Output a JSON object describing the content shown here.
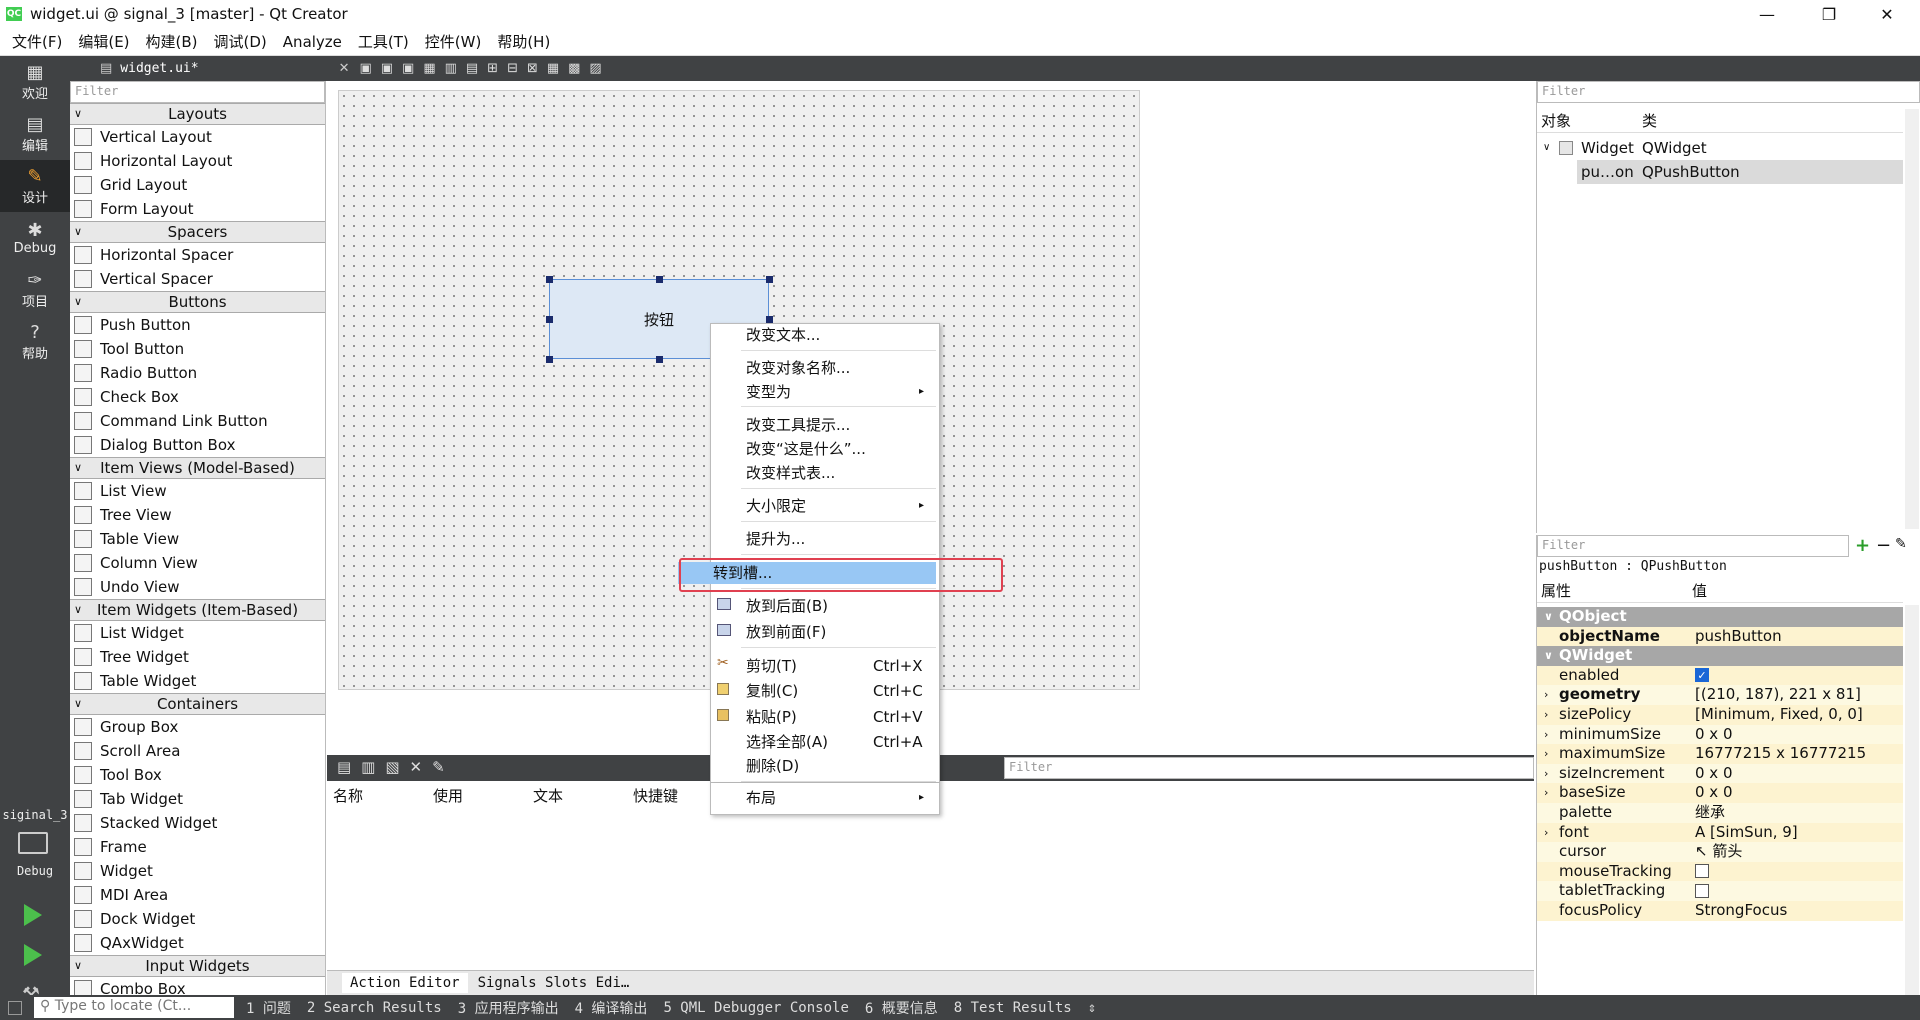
{
  "window": {
    "title": "widget.ui @ signal_3 [master] - Qt Creator",
    "min": "—",
    "max": "❐",
    "close": "✕",
    "app_icon": "QC"
  },
  "menu": [
    "文件(F)",
    "编辑(E)",
    "构建(B)",
    "调试(D)",
    "Analyze",
    "工具(T)",
    "控件(W)",
    "帮助(H)"
  ],
  "modes": [
    {
      "label": "欢迎",
      "icon": "▦"
    },
    {
      "label": "编辑",
      "icon": "▤"
    },
    {
      "label": "设计",
      "icon": "✎"
    },
    {
      "label": "Debug",
      "icon": "✱"
    },
    {
      "label": "项目",
      "icon": "✑"
    },
    {
      "label": "帮助",
      "icon": "?"
    }
  ],
  "kit": {
    "project": "siginal_3",
    "label": "Debug"
  },
  "doc": {
    "file": "widget.ui*"
  },
  "widgetbox": {
    "filter": "Filter",
    "groups": [
      {
        "title": "Layouts",
        "items": [
          "Vertical Layout",
          "Horizontal Layout",
          "Grid Layout",
          "Form Layout"
        ]
      },
      {
        "title": "Spacers",
        "items": [
          "Horizontal Spacer",
          "Vertical Spacer"
        ]
      },
      {
        "title": "Buttons",
        "items": [
          "Push Button",
          "Tool Button",
          "Radio Button",
          "Check Box",
          "Command Link Button",
          "Dialog Button Box"
        ]
      },
      {
        "title": "Item Views (Model-Based)",
        "items": [
          "List View",
          "Tree View",
          "Table View",
          "Column View",
          "Undo View"
        ]
      },
      {
        "title": "Item Widgets (Item-Based)",
        "items": [
          "List Widget",
          "Tree Widget",
          "Table Widget"
        ]
      },
      {
        "title": "Containers",
        "items": [
          "Group Box",
          "Scroll Area",
          "Tool Box",
          "Tab Widget",
          "Stacked Widget",
          "Frame",
          "Widget",
          "MDI Area",
          "Dock Widget",
          "QAxWidget"
        ]
      },
      {
        "title": "Input Widgets",
        "items": [
          "Combo Box"
        ]
      }
    ]
  },
  "canvas": {
    "button_text": "按钮"
  },
  "context_menu": {
    "items": {
      "change_text": "改变文本...",
      "change_name": "改变对象名称...",
      "morph": "变型为",
      "tooltip": "改变工具提示...",
      "whats_this": "改变“这是什么”...",
      "stylesheet": "改变样式表...",
      "size_constraints": "大小限定",
      "promote": "提升为...",
      "goto_slot": "转到槽...",
      "send_back": "放到后面(B)",
      "bring_front": "放到前面(F)",
      "cut": "剪切(T)",
      "copy": "复制(C)",
      "paste": "粘贴(P)",
      "select_all": "选择全部(A)",
      "delete": "删除(D)",
      "layout": "布局"
    },
    "shortcuts": {
      "cut": "Ctrl+X",
      "copy": "Ctrl+C",
      "paste": "Ctrl+V",
      "select_all": "Ctrl+A"
    }
  },
  "action_editor": {
    "filter": "Filter",
    "columns": [
      "名称",
      "使用",
      "文本",
      "快捷键"
    ]
  },
  "bottom_tabs": [
    "Action Editor",
    "Signals  Slots Edi…"
  ],
  "object_inspector": {
    "filter": "Filter",
    "col_object": "对象",
    "col_class": "类",
    "rows": [
      {
        "object": "Widget",
        "class": "QWidget"
      },
      {
        "object": "pu…on",
        "class": "QPushButton"
      }
    ]
  },
  "property_editor": {
    "filter": "Filter",
    "context": "pushButton : QPushButton",
    "col_prop": "属性",
    "col_value": "值",
    "rows": [
      {
        "name": "QObject",
        "group": true
      },
      {
        "name": "objectName",
        "value": "pushButton",
        "bold": true
      },
      {
        "name": "QWidget",
        "group": true
      },
      {
        "name": "enabled",
        "value": "",
        "check": true
      },
      {
        "name": "geometry",
        "value": "[(210, 187), 221 x 81]",
        "bold": true,
        "expand": true
      },
      {
        "name": "sizePolicy",
        "value": "[Minimum, Fixed, 0, 0]",
        "expand": true
      },
      {
        "name": "minimumSize",
        "value": "0 x 0",
        "expand": true
      },
      {
        "name": "maximumSize",
        "value": "16777215 x 16777215",
        "expand": true
      },
      {
        "name": "sizeIncrement",
        "value": "0 x 0",
        "expand": true
      },
      {
        "name": "baseSize",
        "value": "0 x 0",
        "expand": true
      },
      {
        "name": "palette",
        "value": "继承"
      },
      {
        "name": "font",
        "value": "A  [SimSun, 9]",
        "expand": true
      },
      {
        "name": "cursor",
        "value": "↖  箭头"
      },
      {
        "name": "mouseTracking",
        "value": "",
        "check": false
      },
      {
        "name": "tabletTracking",
        "value": "",
        "check": false
      },
      {
        "name": "focusPolicy",
        "value": "StrongFocus"
      }
    ]
  },
  "statusbar": {
    "locate_placeholder": "Type to locate (Ct...",
    "panes": [
      "1 问题",
      "2 Search Results",
      "3 应用程序输出",
      "4 编译输出",
      "5 QML Debugger Console",
      "6 概要信息",
      "8 Test Results"
    ]
  }
}
